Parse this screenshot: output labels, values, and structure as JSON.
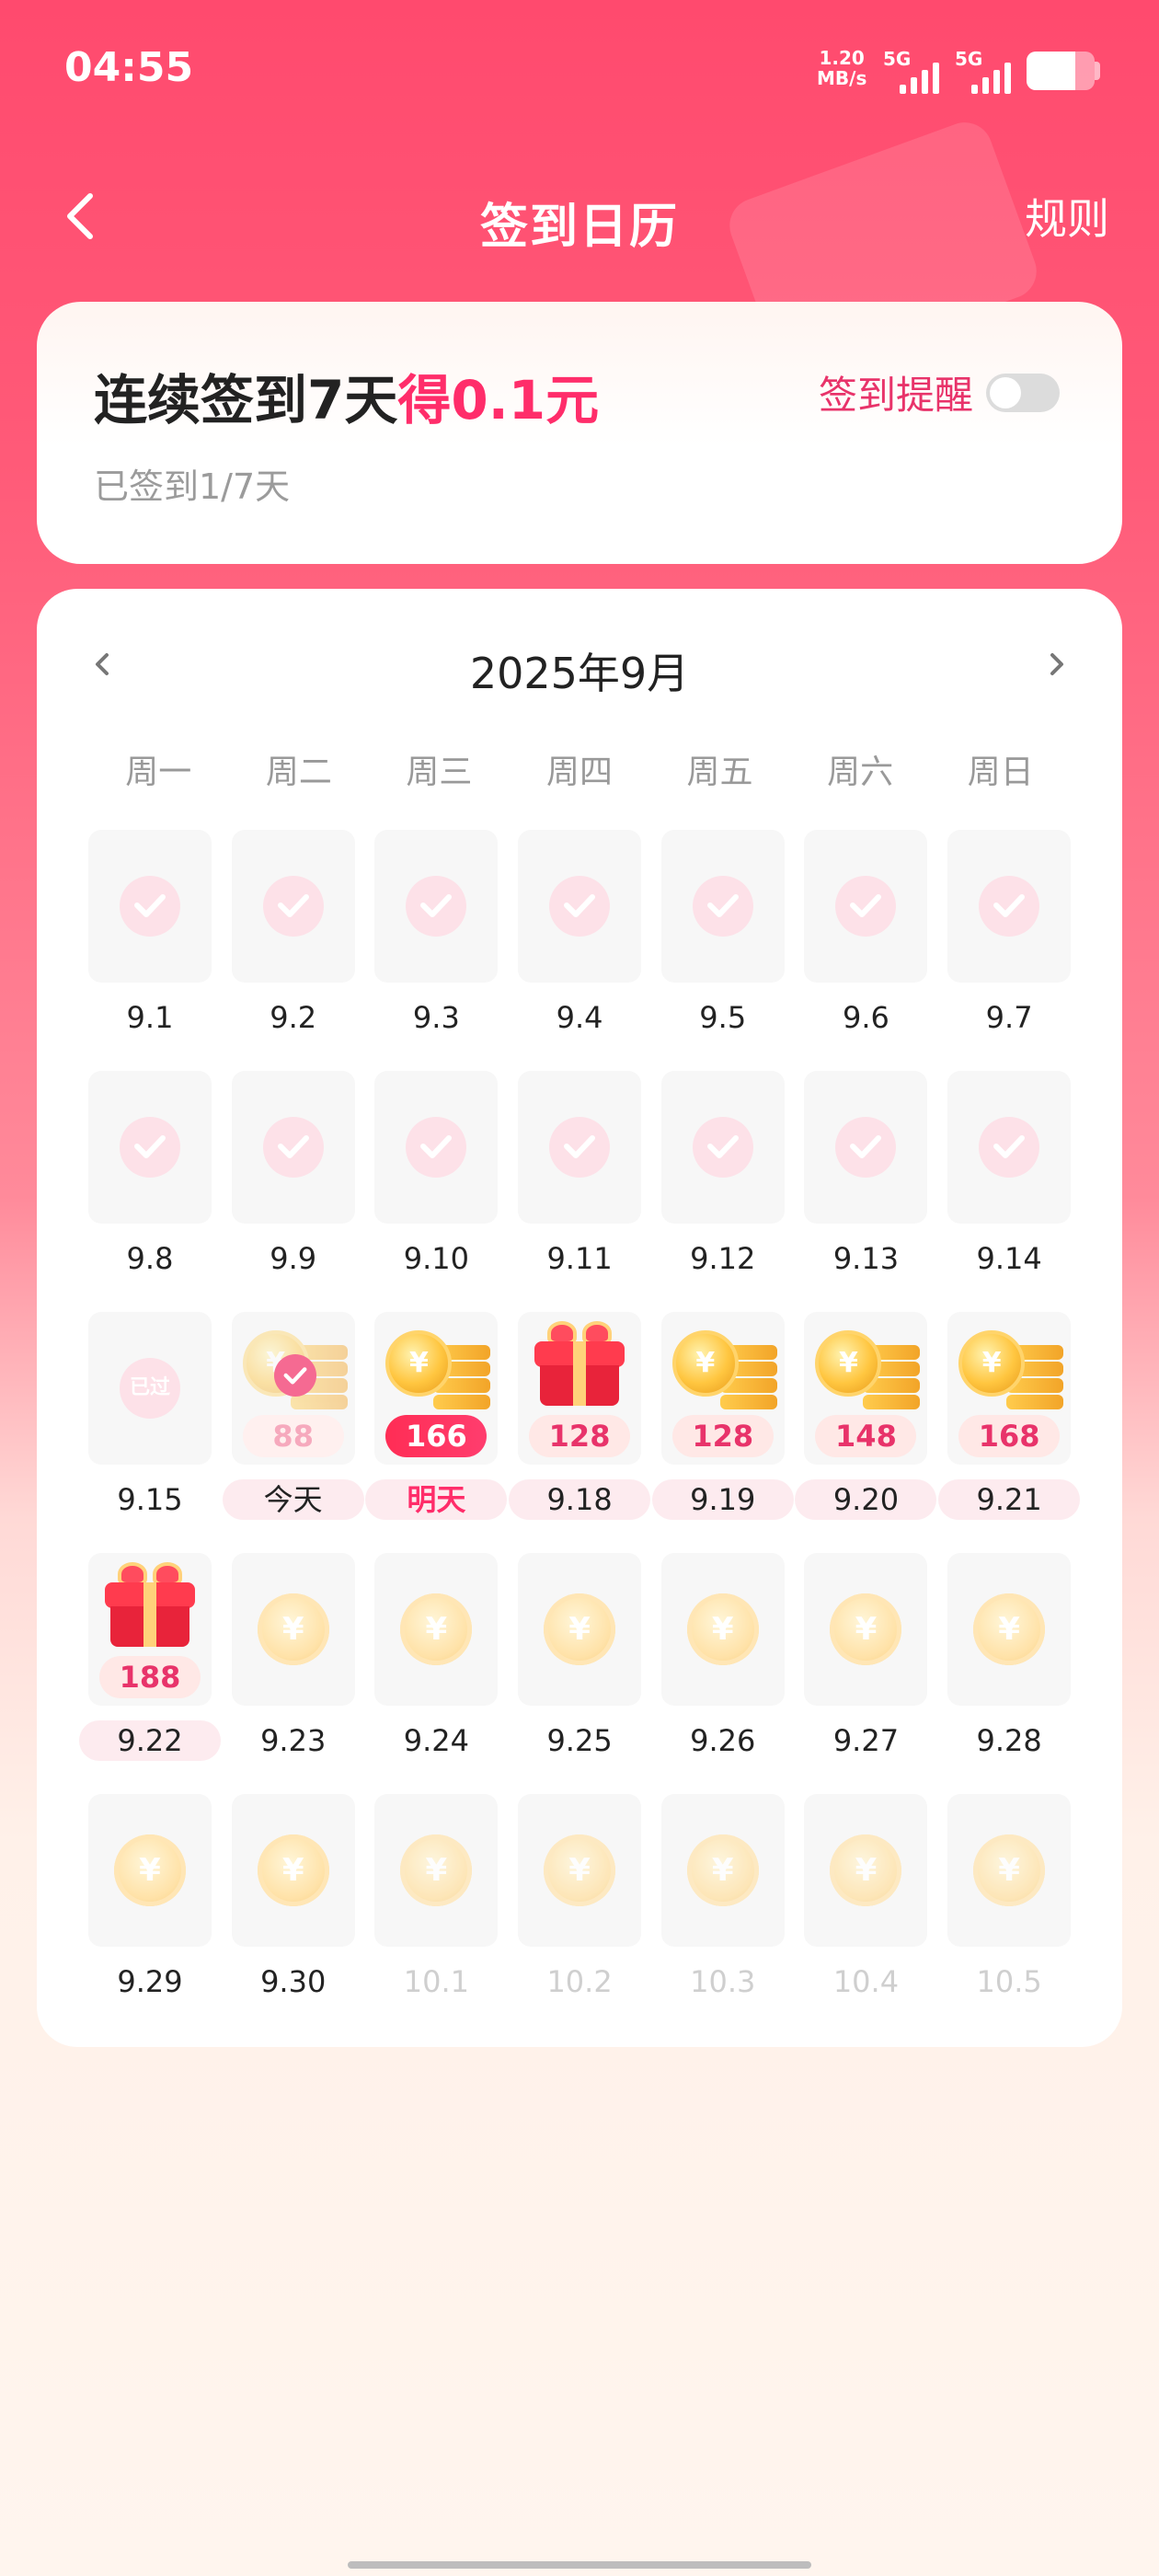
{
  "status_bar": {
    "time": "04:55",
    "net_speed_value": "1.20",
    "net_speed_unit": "MB/s",
    "signal1_tag": "5G",
    "signal2_tag": "5G",
    "battery_level": 0.72
  },
  "header": {
    "title": "签到日历",
    "rules_label": "规则"
  },
  "sign_card": {
    "headline_prefix": "连续签到7天",
    "headline_reward": "得0.1元",
    "progress": "已签到1/7天",
    "reminder_label": "签到提醒",
    "reminder_on": false
  },
  "calendar": {
    "month_label": "2025年9月",
    "weekdays": [
      "周一",
      "周二",
      "周三",
      "周四",
      "周五",
      "周六",
      "周日"
    ],
    "days": [
      {
        "date": "9.1",
        "state": "checked"
      },
      {
        "date": "9.2",
        "state": "checked"
      },
      {
        "date": "9.3",
        "state": "checked"
      },
      {
        "date": "9.4",
        "state": "checked"
      },
      {
        "date": "9.5",
        "state": "checked"
      },
      {
        "date": "9.6",
        "state": "checked"
      },
      {
        "date": "9.7",
        "state": "checked"
      },
      {
        "date": "9.8",
        "state": "checked"
      },
      {
        "date": "9.9",
        "state": "checked"
      },
      {
        "date": "9.10",
        "state": "checked"
      },
      {
        "date": "9.11",
        "state": "checked"
      },
      {
        "date": "9.12",
        "state": "checked"
      },
      {
        "date": "9.13",
        "state": "checked"
      },
      {
        "date": "9.14",
        "state": "checked"
      },
      {
        "date": "9.15",
        "state": "passed",
        "badge": "已过"
      },
      {
        "date": "今天",
        "state": "today",
        "reward": "88",
        "icon": "coin-stack",
        "highlight": true
      },
      {
        "date": "明天",
        "state": "tomorrow",
        "reward": "166",
        "icon": "coin-stack",
        "highlight": true
      },
      {
        "date": "9.18",
        "state": "reward",
        "reward": "128",
        "icon": "gift-box",
        "highlight": true
      },
      {
        "date": "9.19",
        "state": "reward",
        "reward": "128",
        "icon": "coin-stack",
        "highlight": true
      },
      {
        "date": "9.20",
        "state": "reward",
        "reward": "148",
        "icon": "coin-stack",
        "highlight": true
      },
      {
        "date": "9.21",
        "state": "reward",
        "reward": "168",
        "icon": "coin-stack",
        "highlight": true
      },
      {
        "date": "9.22",
        "state": "reward",
        "reward": "188",
        "icon": "gift-box",
        "highlight": true
      },
      {
        "date": "9.23",
        "state": "future"
      },
      {
        "date": "9.24",
        "state": "future"
      },
      {
        "date": "9.25",
        "state": "future"
      },
      {
        "date": "9.26",
        "state": "future"
      },
      {
        "date": "9.27",
        "state": "future"
      },
      {
        "date": "9.28",
        "state": "future"
      },
      {
        "date": "9.29",
        "state": "future"
      },
      {
        "date": "9.30",
        "state": "future"
      },
      {
        "date": "10.1",
        "state": "next-month"
      },
      {
        "date": "10.2",
        "state": "next-month"
      },
      {
        "date": "10.3",
        "state": "next-month"
      },
      {
        "date": "10.4",
        "state": "next-month"
      },
      {
        "date": "10.5",
        "state": "next-month"
      }
    ],
    "coin_symbol": "¥"
  },
  "colors": {
    "brand_pink": "#ff2d6a",
    "header_red": "#ff4a6e",
    "today_pill": "#ff2d55"
  }
}
